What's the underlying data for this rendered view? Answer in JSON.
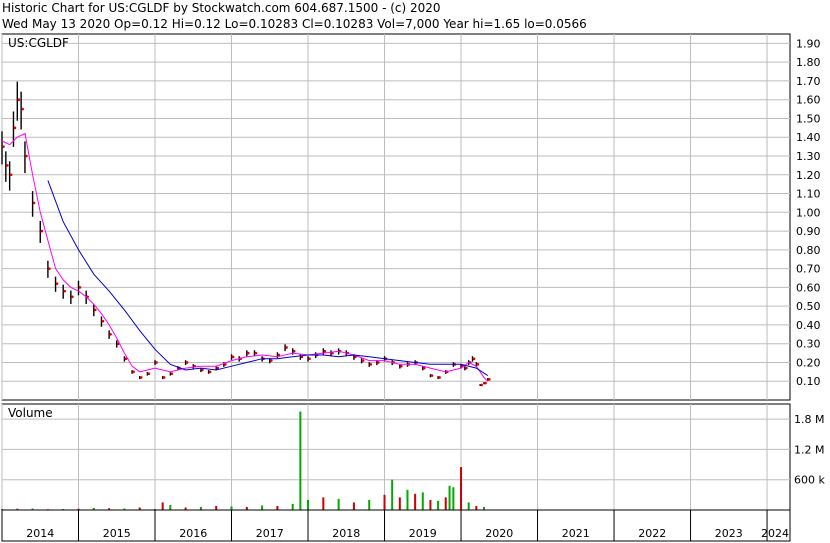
{
  "header": {
    "line1": "Historic Chart for US:CGLDF by Stockwatch.com 604.687.1500 - (c) 2020",
    "line2": "Wed May 13 2020   Op=0.12  Hi=0.12  Lo=0.10283  Cl=0.10283  Vol=7,000  Year hi=1.65  lo=0.0566"
  },
  "colors": {
    "grid": "#bdbdbd",
    "price_bar": "#000000",
    "price_down_marker": "#dd0000",
    "ma_short": "#ff00ff",
    "ma_long": "#0000cc",
    "volume_up": "#00aa00",
    "volume_down": "#cc0000"
  },
  "chart_data": [
    {
      "type": "line",
      "title": "US:CGLDF",
      "ylim": [
        0.0,
        1.95
      ],
      "yticks": [
        "1.90",
        "1.80",
        "1.70",
        "1.60",
        "1.50",
        "1.40",
        "1.30",
        "1.20",
        "1.10",
        "1.00",
        "0.90",
        "0.80",
        "0.70",
        "0.60",
        "0.50",
        "0.40",
        "0.30",
        "0.20",
        "0.10"
      ],
      "x_range": [
        2014.0,
        2024.3
      ],
      "xlabels": [
        "2014",
        "2015",
        "2016",
        "2017",
        "2018",
        "2019",
        "2020",
        "2021",
        "2022",
        "2023",
        "2024"
      ],
      "grid": true,
      "series": [
        {
          "style": "price",
          "x": [
            2014.0,
            2014.05,
            2014.1,
            2014.15,
            2014.2,
            2014.25,
            2014.3,
            2014.4,
            2014.5,
            2014.6,
            2014.7,
            2014.8,
            2014.9,
            2015.0,
            2015.1,
            2015.2,
            2015.3,
            2015.4,
            2015.5,
            2015.6,
            2015.7,
            2015.8,
            2015.9,
            2016.0,
            2016.1,
            2016.2,
            2016.3,
            2016.4,
            2016.5,
            2016.6,
            2016.7,
            2016.8,
            2016.9,
            2017.0,
            2017.1,
            2017.2,
            2017.3,
            2017.4,
            2017.5,
            2017.6,
            2017.7,
            2017.8,
            2017.9,
            2018.0,
            2018.1,
            2018.2,
            2018.3,
            2018.4,
            2018.5,
            2018.6,
            2018.7,
            2018.8,
            2018.9,
            2019.0,
            2019.1,
            2019.2,
            2019.3,
            2019.4,
            2019.5,
            2019.6,
            2019.7,
            2019.8,
            2019.9,
            2020.0,
            2020.05,
            2020.1,
            2020.15,
            2020.2,
            2020.25,
            2020.3,
            2020.35
          ],
          "values": [
            1.35,
            1.25,
            1.2,
            1.45,
            1.6,
            1.55,
            1.3,
            1.05,
            0.9,
            0.7,
            0.62,
            0.58,
            0.55,
            0.6,
            0.55,
            0.48,
            0.42,
            0.35,
            0.3,
            0.22,
            0.15,
            0.12,
            0.14,
            0.2,
            0.12,
            0.14,
            0.17,
            0.2,
            0.18,
            0.16,
            0.15,
            0.17,
            0.19,
            0.23,
            0.22,
            0.25,
            0.25,
            0.22,
            0.21,
            0.24,
            0.28,
            0.26,
            0.23,
            0.22,
            0.24,
            0.26,
            0.25,
            0.26,
            0.25,
            0.23,
            0.21,
            0.19,
            0.2,
            0.22,
            0.2,
            0.18,
            0.19,
            0.2,
            0.17,
            0.13,
            0.12,
            0.15,
            0.19,
            0.18,
            0.17,
            0.2,
            0.22,
            0.19,
            0.08,
            0.09,
            0.11
          ]
        },
        {
          "style": "ma-short",
          "x": [
            2014.0,
            2014.1,
            2014.2,
            2014.3,
            2014.4,
            2014.5,
            2014.6,
            2014.7,
            2014.8,
            2014.9,
            2015.0,
            2015.1,
            2015.2,
            2015.3,
            2015.4,
            2015.5,
            2015.6,
            2015.7,
            2015.8,
            2015.9,
            2016.0,
            2016.2,
            2016.4,
            2016.6,
            2016.8,
            2017.0,
            2017.2,
            2017.4,
            2017.6,
            2017.8,
            2018.0,
            2018.2,
            2018.4,
            2018.6,
            2018.8,
            2019.0,
            2019.2,
            2019.4,
            2019.6,
            2019.8,
            2020.0,
            2020.1,
            2020.2,
            2020.3,
            2020.35
          ],
          "values": [
            1.38,
            1.36,
            1.4,
            1.42,
            1.2,
            1.0,
            0.85,
            0.7,
            0.64,
            0.6,
            0.58,
            0.55,
            0.51,
            0.46,
            0.4,
            0.33,
            0.25,
            0.18,
            0.15,
            0.16,
            0.17,
            0.15,
            0.17,
            0.18,
            0.18,
            0.21,
            0.23,
            0.24,
            0.23,
            0.25,
            0.24,
            0.25,
            0.26,
            0.24,
            0.21,
            0.21,
            0.19,
            0.19,
            0.17,
            0.15,
            0.17,
            0.2,
            0.18,
            0.12,
            0.1
          ]
        },
        {
          "style": "ma-long",
          "x": [
            2014.6,
            2014.8,
            2015.0,
            2015.2,
            2015.4,
            2015.6,
            2015.8,
            2016.0,
            2016.2,
            2016.4,
            2016.6,
            2016.8,
            2017.0,
            2017.2,
            2017.4,
            2017.6,
            2017.8,
            2018.0,
            2018.2,
            2018.4,
            2018.6,
            2018.8,
            2019.0,
            2019.2,
            2019.4,
            2019.6,
            2019.8,
            2020.0,
            2020.2,
            2020.35
          ],
          "values": [
            1.17,
            0.95,
            0.8,
            0.67,
            0.58,
            0.48,
            0.37,
            0.27,
            0.19,
            0.16,
            0.17,
            0.16,
            0.18,
            0.2,
            0.22,
            0.22,
            0.23,
            0.24,
            0.24,
            0.23,
            0.24,
            0.23,
            0.22,
            0.21,
            0.2,
            0.19,
            0.19,
            0.19,
            0.17,
            0.13
          ]
        }
      ]
    },
    {
      "type": "bar",
      "title": "Volume",
      "ylim": [
        0,
        2100000
      ],
      "yticks": [
        "1.8 M",
        "1.2 M",
        "600 k"
      ],
      "ytick_values": [
        1800000,
        1200000,
        600000
      ],
      "x_range": [
        2014.0,
        2024.3
      ],
      "grid": true,
      "series": [
        {
          "x": [
            2014.0,
            2014.2,
            2014.4,
            2014.6,
            2014.8,
            2015.0,
            2015.2,
            2015.4,
            2015.6,
            2015.8,
            2016.0,
            2016.1,
            2016.2,
            2016.4,
            2016.6,
            2016.8,
            2017.0,
            2017.2,
            2017.4,
            2017.6,
            2017.8,
            2017.9,
            2018.0,
            2018.2,
            2018.4,
            2018.6,
            2018.8,
            2019.0,
            2019.1,
            2019.2,
            2019.3,
            2019.4,
            2019.5,
            2019.6,
            2019.7,
            2019.8,
            2019.85,
            2019.9,
            2020.0,
            2020.1,
            2020.2,
            2020.3
          ],
          "values": [
            20000,
            25000,
            30000,
            15000,
            20000,
            25000,
            40000,
            35000,
            30000,
            50000,
            20000,
            150000,
            100000,
            50000,
            60000,
            80000,
            70000,
            60000,
            90000,
            80000,
            120000,
            1950000,
            200000,
            250000,
            220000,
            150000,
            200000,
            300000,
            600000,
            250000,
            400000,
            320000,
            350000,
            200000,
            180000,
            250000,
            480000,
            450000,
            850000,
            150000,
            80000,
            60000
          ],
          "up": [
            true,
            false,
            true,
            false,
            true,
            false,
            true,
            false,
            true,
            false,
            true,
            false,
            true,
            false,
            true,
            false,
            true,
            false,
            true,
            false,
            true,
            true,
            true,
            false,
            true,
            false,
            true,
            false,
            true,
            false,
            true,
            false,
            true,
            false,
            true,
            false,
            true,
            true,
            false,
            true,
            false,
            true
          ]
        }
      ]
    }
  ]
}
